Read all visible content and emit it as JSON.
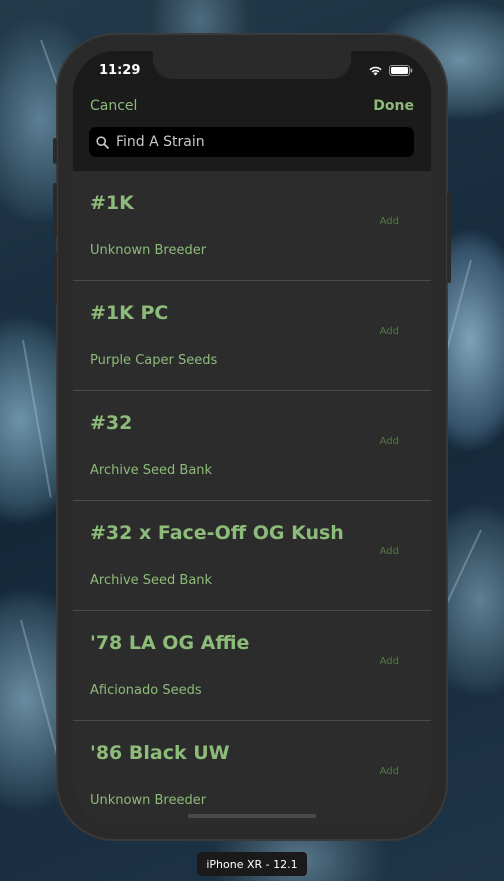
{
  "status_bar": {
    "time": "11:29"
  },
  "nav": {
    "cancel_label": "Cancel",
    "done_label": "Done"
  },
  "search": {
    "placeholder": "Find A Strain",
    "value": ""
  },
  "strains": [
    {
      "name": "#1K",
      "breeder": "Unknown Breeder",
      "action": "Add"
    },
    {
      "name": "#1K PC",
      "breeder": "Purple Caper Seeds",
      "action": "Add"
    },
    {
      "name": "#32",
      "breeder": "Archive Seed Bank",
      "action": "Add"
    },
    {
      "name": "#32 x Face-Off OG Kush",
      "breeder": "Archive Seed Bank",
      "action": "Add"
    },
    {
      "name": "'78 LA OG Affie",
      "breeder": "Aficionado Seeds",
      "action": "Add"
    },
    {
      "name": "'86 Black UW",
      "breeder": "Unknown Breeder",
      "action": "Add"
    }
  ],
  "device_label": "iPhone XR - 12.1",
  "colors": {
    "accent_green": "#8dbb7a",
    "add_green": "#4f7d3e",
    "list_bg": "#2c2c2c"
  }
}
